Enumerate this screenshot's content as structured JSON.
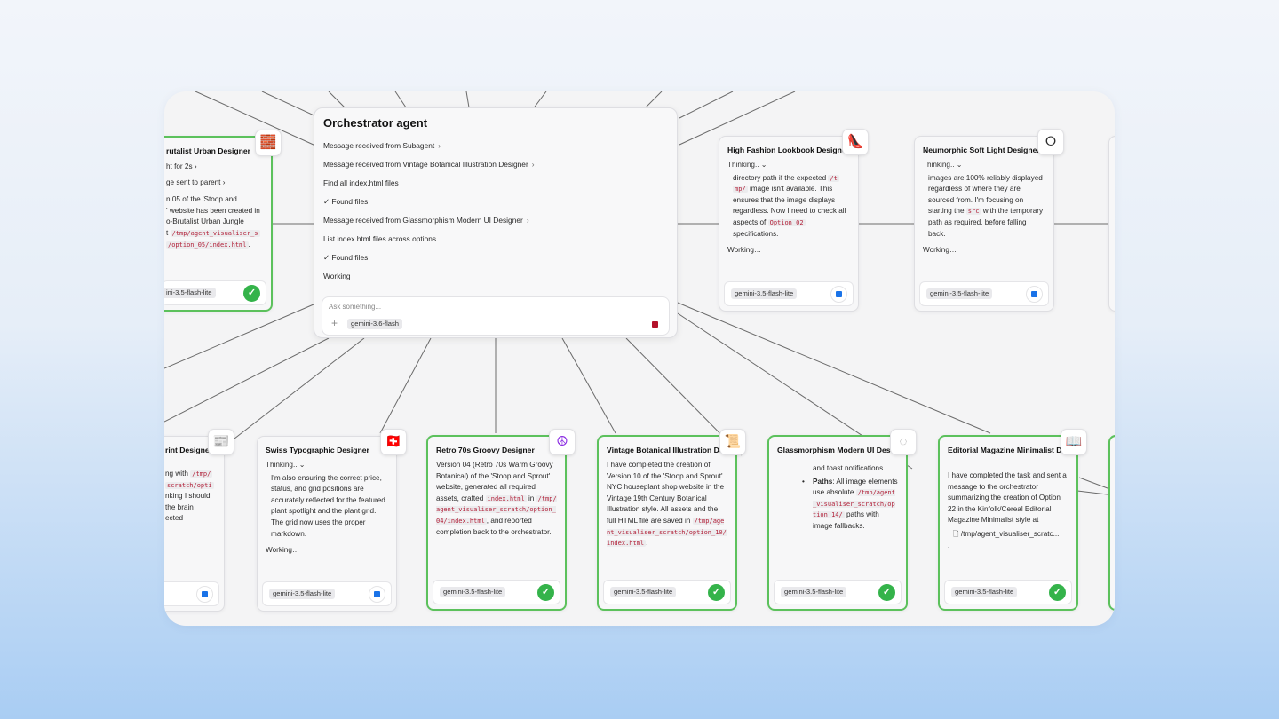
{
  "orchestrator": {
    "title": "Orchestrator agent",
    "items": [
      {
        "text": "Message received from Subagent",
        "chevron": "›"
      },
      {
        "text": "Message received from Vintage Botanical Illustration Designer",
        "chevron": "›"
      },
      {
        "text": "Find all index.html files",
        "chevron": ""
      },
      {
        "text": "✓ Found files",
        "chevron": ""
      },
      {
        "text": "Message received from Glassmorphism Modern UI Designer",
        "chevron": "›"
      },
      {
        "text": "List index.html files across options",
        "chevron": ""
      },
      {
        "text": "✓ Found files",
        "chevron": ""
      },
      {
        "text": "Working",
        "chevron": ""
      }
    ],
    "input_placeholder": "Ask something...",
    "plus": "+",
    "model": "gemini-3.6-flash"
  },
  "cards": {
    "brutalist": {
      "title": "rutalist Urban Designer",
      "icon": "🧱",
      "line1": "ht for 2s ›",
      "line2": "ge sent to parent ›",
      "text_a": "n 05 of the 'Stoop and",
      "text_b": "' website has been created in",
      "text_c": "o-Brutalist Urban Jungle",
      "text_d": "t",
      "code1": "/tmp/agent_visualiser_s",
      "code2": "/option_05/index.html",
      "text_e": ".",
      "model": "ini-3.5-flash-lite",
      "check": "✓"
    },
    "fashion": {
      "title": "High Fashion Lookbook Designer",
      "icon": "👠",
      "thinking": "Thinking.. ⌄",
      "t1": "directory path if the expected",
      "c1": "/t",
      "c2": "mp/",
      "t2": "image isn't available. This ensures that the image displays regardless. Now I need to check all aspects of",
      "c3": "Option 02",
      "t3": "specifications.",
      "working": "Working…",
      "model": "gemini-3.5-flash-lite"
    },
    "neumorphic": {
      "title": "Neumorphic Soft Light Designer",
      "icon": "⭘",
      "thinking": "Thinking.. ⌄",
      "t1": "images are 100% reliably displayed regardless of where they are sourced from. I'm focusing on starting the",
      "c1": "src",
      "t2": "with the temporary path as required, before falling back.",
      "working": "Working…",
      "model": "gemini-3.5-flash-lite"
    },
    "print": {
      "title": "rint Designe",
      "icon": "📰",
      "t1": "ng with",
      "c1": "/tmp/",
      "c2": "scratch/opti",
      "t2": "nking I should",
      "t3": "the brain",
      "t4": "ected",
      "model": ""
    },
    "swiss": {
      "title": "Swiss Typographic Designer",
      "icon": "🇨🇭",
      "thinking": "Thinking.. ⌄",
      "t1": "I'm also ensuring the correct price, status, and grid positions are accurately reflected for the featured plant spotlight and the plant grid. The grid now uses the proper markdown.",
      "working": "Working…",
      "model": "gemini-3.5-flash-lite"
    },
    "retro": {
      "title": "Retro 70s Groovy Designer",
      "icon": "☮",
      "t1": "Version 04 (Retro 70s Warm Groovy Botanical) of the 'Stoop and Sprout' website, generated all required assets, crafted",
      "c1": "index.html",
      "t2": "in",
      "c2": "/tmp/agent_visualiser_scratch/option_04/index.html",
      "t3": ", and reported completion back to the orchestrator.",
      "model": "gemini-3.5-flash-lite",
      "check": "✓"
    },
    "vintage": {
      "title": "Vintage Botanical Illustration De",
      "icon": "📜",
      "t1": "I have completed the creation of Version 10 of the 'Stoop and Sprout' NYC houseplant shop website in the Vintage 19th Century Botanical Illustration style. All assets and the full HTML file are saved in",
      "c1": "/tmp/agent_visualiser_scratch/option_10/index.html",
      "t2": ".",
      "model": "gemini-3.5-flash-lite",
      "check": "✓"
    },
    "glass": {
      "title": "Glassmorphism Modern UI Des",
      "icon": "◌",
      "t0": "and toast notifications.",
      "bullet": "•",
      "bold": "Paths",
      "t1": ": All image elements use absolute",
      "c1": "/tmp/agent_visualiser_scratch/option_14/",
      "t2": "paths with image fallbacks.",
      "model": "gemini-3.5-flash-lite",
      "check": "✓"
    },
    "editorial": {
      "title": "Editorial Magazine Minimalist D",
      "icon": "📖",
      "t1": "I have completed the task and sent a message to the orchestrator summarizing the creation of Option 22 in the Kinfolk/Cereal Editorial Magazine Minimalist style at",
      "file_icon": "🗋",
      "file": "/tmp/agent_visualiser_scratc...",
      "t2": ".",
      "model": "gemini-3.5-flash-lite",
      "check": "✓"
    }
  }
}
